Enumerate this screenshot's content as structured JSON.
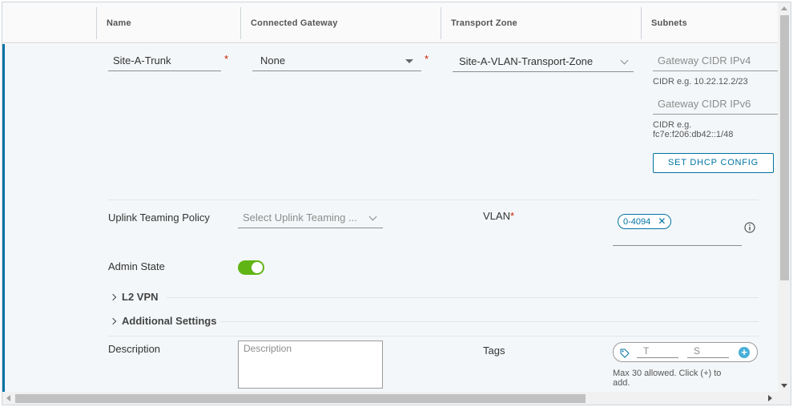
{
  "header": {
    "columns": [
      "Name",
      "Connected Gateway",
      "Transport Zone",
      "Subnets"
    ]
  },
  "row": {
    "name_value": "Site-A-Trunk",
    "gateway_value": "None",
    "transport_zone_value": "Site-A-VLAN-Transport-Zone",
    "required_mark": "*",
    "subnets": {
      "ipv4_placeholder": "Gateway CIDR IPv4",
      "ipv4_hint": "CIDR e.g. 10.22.12.2/23",
      "ipv6_placeholder": "Gateway CIDR IPv6",
      "ipv6_hint_line1": "CIDR e.g.",
      "ipv6_hint_line2": "fc7e:f206:db42::1/48",
      "dhcp_button": "SET DHCP CONFIG"
    },
    "uplink_teaming": {
      "label": "Uplink Teaming Policy",
      "placeholder": "Select Uplink Teaming ..."
    },
    "vlan": {
      "label": "VLAN",
      "chip": "0-4094"
    },
    "admin_state": {
      "label": "Admin State",
      "enabled": true
    },
    "sections": {
      "l2vpn": "L2 VPN",
      "additional": "Additional Settings"
    },
    "description": {
      "label": "Description",
      "placeholder": "Description"
    },
    "tags": {
      "label": "Tags",
      "tag_placeholder": "T",
      "scope_placeholder": "S",
      "hint_line1": "Max 30 allowed. Click (+) to",
      "hint_line2": "add."
    }
  },
  "colors": {
    "accent": "#0072a3",
    "required": "#c92100",
    "toggle_on": "#60b515"
  }
}
